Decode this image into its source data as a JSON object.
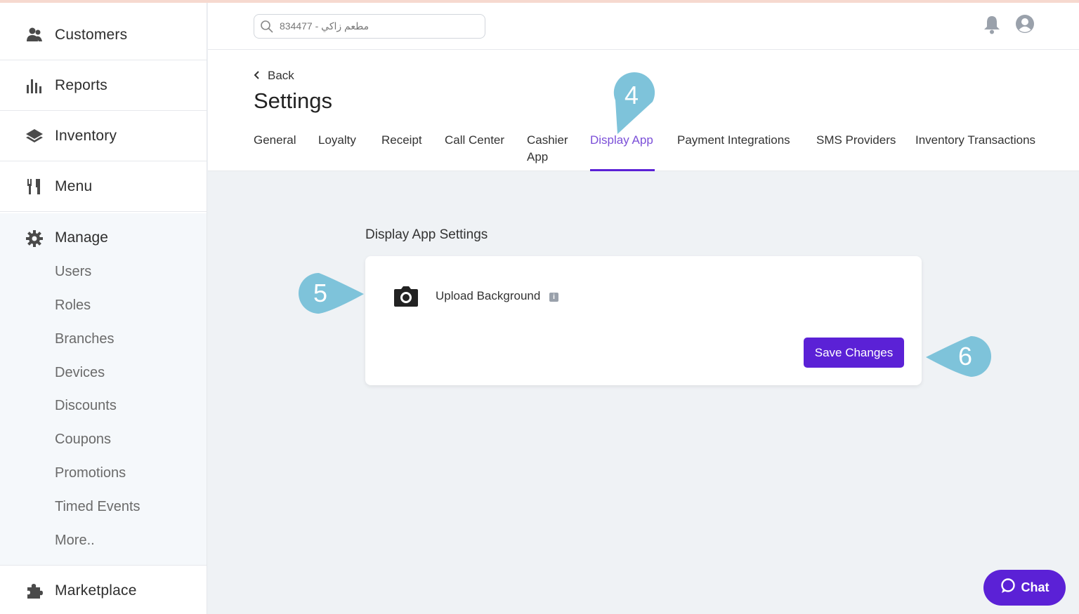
{
  "sidebar": {
    "items": [
      {
        "label": "Customers",
        "icon": "customers-icon"
      },
      {
        "label": "Reports",
        "icon": "bar-chart-icon"
      },
      {
        "label": "Inventory",
        "icon": "layers-icon"
      },
      {
        "label": "Menu",
        "icon": "utensils-icon"
      }
    ],
    "manage": {
      "label": "Manage",
      "icon": "gear-icon",
      "subitems": [
        "Users",
        "Roles",
        "Branches",
        "Devices",
        "Discounts",
        "Coupons",
        "Promotions",
        "Timed Events",
        "More.."
      ]
    },
    "marketplace": {
      "label": "Marketplace",
      "icon": "puzzle-icon"
    }
  },
  "header": {
    "search_placeholder": "مطعم زاكي - 834477"
  },
  "settings": {
    "back_label": "Back",
    "title": "Settings",
    "tabs": [
      {
        "label": "General"
      },
      {
        "label": "Loyalty"
      },
      {
        "label": "Receipt"
      },
      {
        "label": "Call Center"
      },
      {
        "label": "Cashier App"
      },
      {
        "label": "Display App",
        "active": true
      },
      {
        "label": "Payment Integrations"
      },
      {
        "label": "SMS Providers"
      },
      {
        "label": "Inventory Transactions"
      }
    ]
  },
  "main": {
    "section_title": "Display App Settings",
    "upload_label": "Upload Background",
    "save_label": "Save Changes"
  },
  "callouts": {
    "tab": "4",
    "upload": "5",
    "save": "6"
  },
  "chat": {
    "label": "Chat"
  },
  "colors": {
    "accent": "#5b21d6",
    "active_tab": "#7b4fd8",
    "callout": "#7ec3da"
  }
}
